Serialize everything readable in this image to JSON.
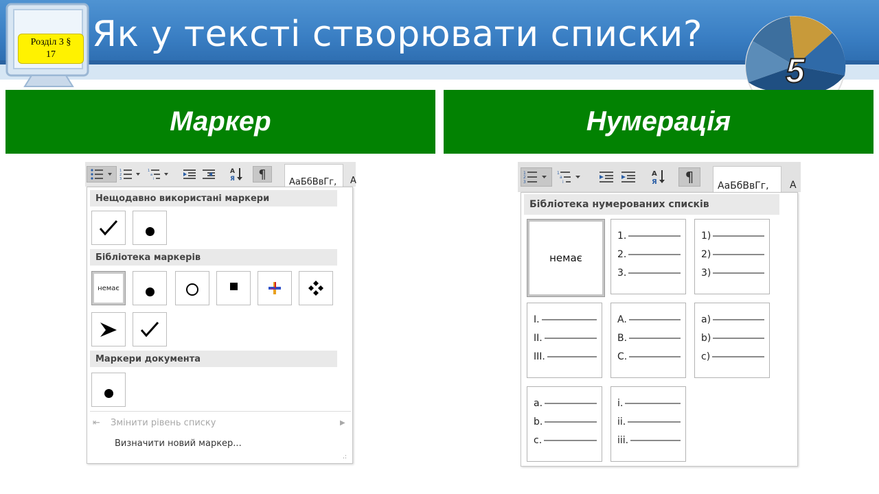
{
  "header": {
    "section_badge_line1": "Розділ 3 §",
    "section_badge_line2": "17",
    "title": "Як у тексті створювати списки?",
    "logo_number": "5"
  },
  "columns": {
    "left_heading": "Маркер",
    "right_heading": "Нумерація"
  },
  "bullet_panel": {
    "style_preview": "АаБбВвГг,",
    "style_preview_next": "А",
    "recent_section": "Нещодавно використані маркери",
    "library_section": "Бібліотека маркерів",
    "library_none": "немає",
    "document_section": "Маркери документа",
    "change_level": "Змінити рівень списку",
    "define_new": "Визначити новий маркер...",
    "recent_items": [
      "check-bullet",
      "dot-bullet"
    ],
    "library_items": [
      "none",
      "dot-bullet",
      "circle-bullet",
      "square-bullet",
      "colored-cross-bullet",
      "four-diamond-bullet",
      "arrowhead-bullet",
      "check-bullet"
    ],
    "document_items": [
      "dot-bullet"
    ]
  },
  "numbering_panel": {
    "style_preview": "АаБбВвГг,",
    "style_preview_next": "А",
    "library_section": "Бібліотека нумерованих списків",
    "none_label": "немає",
    "formats": [
      {
        "l1": "1.",
        "l2": "2.",
        "l3": "3."
      },
      {
        "l1": "1)",
        "l2": "2)",
        "l3": "3)"
      },
      {
        "l1": "I.",
        "l2": "II.",
        "l3": "III."
      },
      {
        "l1": "A.",
        "l2": "B.",
        "l3": "C."
      },
      {
        "l1": "a)",
        "l2": "b)",
        "l3": "c)"
      },
      {
        "l1": "a.",
        "l2": "b.",
        "l3": "c."
      },
      {
        "l1": "i.",
        "l2": "ii.",
        "l3": "iii."
      }
    ]
  },
  "colors": {
    "header_blue": "#3a7fc4",
    "heading_green": "#028202",
    "badge_yellow": "#fff200"
  }
}
